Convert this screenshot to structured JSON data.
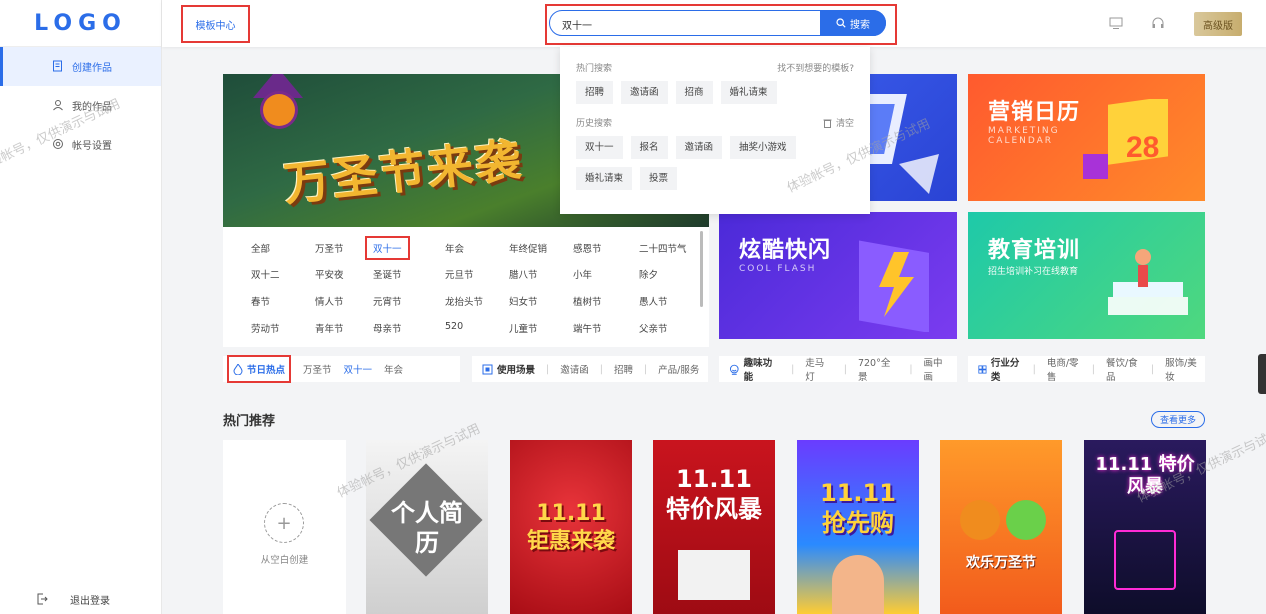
{
  "sidebar": {
    "logo": "LOGO",
    "items": [
      {
        "label": "创建作品"
      },
      {
        "label": "我的作品"
      },
      {
        "label": "帐号设置"
      }
    ],
    "logout": "退出登录"
  },
  "header": {
    "breadcrumb": "模板中心",
    "search_value": "双十一",
    "search_button": "搜索",
    "upgrade": "高级版"
  },
  "dropdown": {
    "hot_title": "热门搜索",
    "not_found": "找不到想要的模板?",
    "hot_tags": [
      "招聘",
      "邀请函",
      "招商",
      "婚礼请柬"
    ],
    "history_title": "历史搜索",
    "clear": "清空",
    "history_tags": [
      "双十一",
      "报名",
      "邀请函",
      "抽奖小游戏",
      "婚礼请柬",
      "投票"
    ]
  },
  "banner": {
    "main_text": "万圣节来袭"
  },
  "categories": {
    "rows": [
      [
        "全部",
        "万圣节",
        "双十一",
        "年会",
        "年终促销",
        "感恩节",
        "二十四节气"
      ],
      [
        "双十二",
        "平安夜",
        "圣诞节",
        "元旦节",
        "腊八节",
        "小年",
        "除夕"
      ],
      [
        "春节",
        "情人节",
        "元宵节",
        "龙抬头节",
        "妇女节",
        "植树节",
        "愚人节"
      ],
      [
        "劳动节",
        "青年节",
        "母亲节",
        "520",
        "儿童节",
        "端午节",
        "父亲节"
      ]
    ]
  },
  "tiles": [
    {
      "title": "",
      "sub": ""
    },
    {
      "title": "营销日历",
      "sub": "MARKETING CALENDAR"
    },
    {
      "title": "炫酷快闪",
      "sub": "COOL FLASH"
    },
    {
      "title": "教育培训",
      "sub": "招生培训补习在线教育"
    }
  ],
  "catbar": [
    {
      "head": "节日热点",
      "items": [
        "万圣节",
        "双十一",
        "年会"
      ]
    },
    {
      "head": "使用场景",
      "items": [
        "邀请函",
        "招聘",
        "产品/服务"
      ]
    },
    {
      "head": "趣味功能",
      "items": [
        "走马灯",
        "720°全景",
        "画中画"
      ]
    },
    {
      "head": "行业分类",
      "items": [
        "电商/零售",
        "餐饮/食品",
        "服饰/美妆"
      ]
    }
  ],
  "hot": {
    "title": "热门推荐",
    "more": "查看更多",
    "blank_label": "从空白创建",
    "cards": [
      {
        "text": "个人简历"
      },
      {
        "text": "11.11 钜惠来袭"
      },
      {
        "text": "11.11 特价风暴"
      },
      {
        "text": "11.11 抢先购"
      },
      {
        "text": "欢乐万圣节"
      },
      {
        "text": "11.11 特价风暴"
      }
    ]
  },
  "watermark": "体验帐号，仅供演示与试用",
  "colors": {
    "accent": "#2b6de8",
    "highlight": "#e53935"
  }
}
